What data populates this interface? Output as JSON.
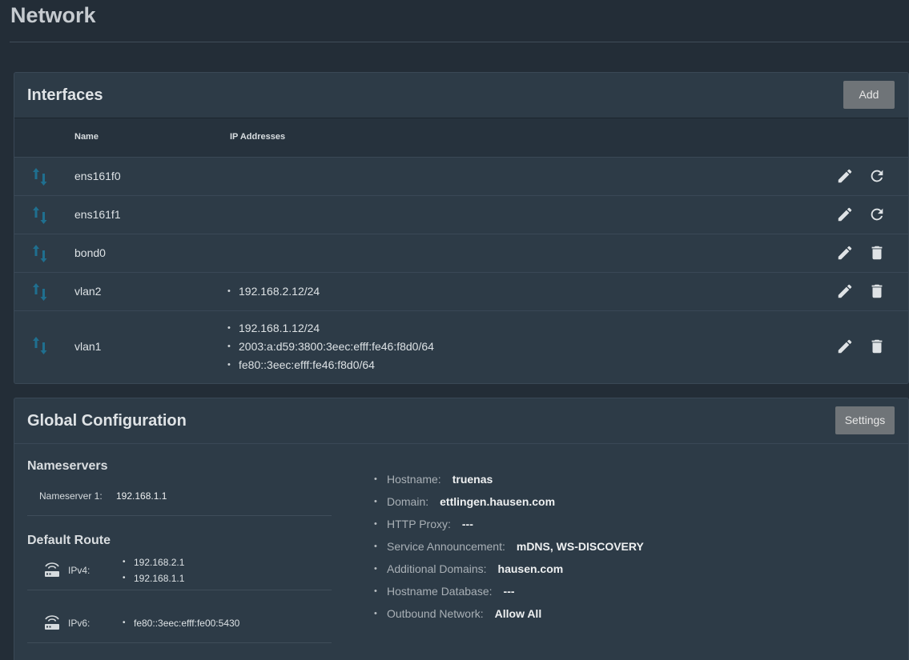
{
  "page": {
    "title": "Network"
  },
  "interfaces": {
    "title": "Interfaces",
    "add_label": "Add",
    "columns": {
      "name": "Name",
      "ips": "IP Addresses"
    },
    "rows": [
      {
        "name": "ens161f0",
        "ips": [],
        "secondary_action": "refresh-icon"
      },
      {
        "name": "ens161f1",
        "ips": [],
        "secondary_action": "refresh-icon"
      },
      {
        "name": "bond0",
        "ips": [],
        "secondary_action": "trash-icon"
      },
      {
        "name": "vlan2",
        "ips": [
          "192.168.2.12/24"
        ],
        "secondary_action": "trash-icon"
      },
      {
        "name": "vlan1",
        "ips": [
          "192.168.1.12/24",
          "2003:a:d59:3800:3eec:efff:fe46:f8d0/64",
          "fe80::3eec:efff:fe46:f8d0/64"
        ],
        "secondary_action": "trash-icon"
      }
    ]
  },
  "global": {
    "title": "Global Configuration",
    "settings_label": "Settings",
    "nameservers": {
      "title": "Nameservers",
      "items": [
        {
          "label": "Nameserver 1:",
          "value": "192.168.1.1"
        }
      ]
    },
    "default_route": {
      "title": "Default Route",
      "ipv4": {
        "label": "IPv4:",
        "values": [
          "192.168.2.1",
          "192.168.1.1"
        ]
      },
      "ipv6": {
        "label": "IPv6:",
        "values": [
          "fe80::3eec:efff:fe00:5430"
        ]
      }
    },
    "info": [
      {
        "label": "Hostname:",
        "value": "truenas"
      },
      {
        "label": "Domain:",
        "value": "ettlingen.hausen.com"
      },
      {
        "label": "HTTP Proxy:",
        "value": "---"
      },
      {
        "label": "Service Announcement:",
        "value": "mDNS, WS-DISCOVERY"
      },
      {
        "label": "Additional Domains:",
        "value": "hausen.com"
      },
      {
        "label": "Hostname Database:",
        "value": "---"
      },
      {
        "label": "Outbound Network:",
        "value": "Allow All"
      }
    ]
  },
  "colors": {
    "background": "#232d37",
    "card": "#2d3b47",
    "button": "#6f7478",
    "iface_icon": "#1f6f8f"
  }
}
